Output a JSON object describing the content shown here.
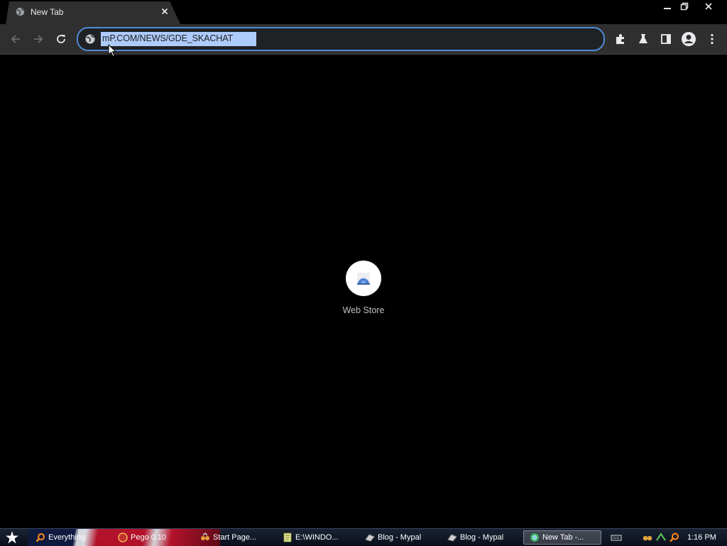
{
  "browser": {
    "tab": {
      "title": "New Tab",
      "favicon": "globe-icon"
    },
    "window_controls": [
      "minimize-icon",
      "restore-icon",
      "close-icon"
    ],
    "toolbar": {
      "nav_icons": [
        "back-arrow-icon",
        "forward-arrow-icon",
        "reload-icon"
      ],
      "address": "mP.COM/NEWS/GDE_SKACHAT",
      "site_icon": "globe-icon",
      "right_icons": [
        "extensions-puzzle-icon",
        "labs-flask-icon",
        "side-panel-icon",
        "profile-avatar-icon",
        "more-menu-icon"
      ]
    },
    "accent_color": "#4f8ad6",
    "selection_color": "#aecbfa"
  },
  "new_tab_page": {
    "shortcuts": [
      {
        "label": "Web Store",
        "icon": "web-store-icon"
      }
    ]
  },
  "taskbar": {
    "items": [
      {
        "label": "Everything",
        "icon": "search-icon"
      },
      {
        "label": "Pego 0.10",
        "icon": "pego-icon"
      },
      {
        "label": "Start Page...",
        "icon": "mypal-icon"
      },
      {
        "label": "E:\\WINDO...",
        "icon": "notepad-icon"
      },
      {
        "label": "Blog - Mypal",
        "icon": "mypal-icon"
      },
      {
        "label": "Blog - Mypal",
        "icon": "mypal-icon"
      },
      {
        "label": "New Tab -...",
        "icon": "chrome-icon",
        "active": true
      }
    ],
    "tray_icons": [
      "keyboard-icon",
      "mypal-icon",
      "network-icon",
      "search-icon"
    ],
    "clock": "1:16 PM"
  }
}
